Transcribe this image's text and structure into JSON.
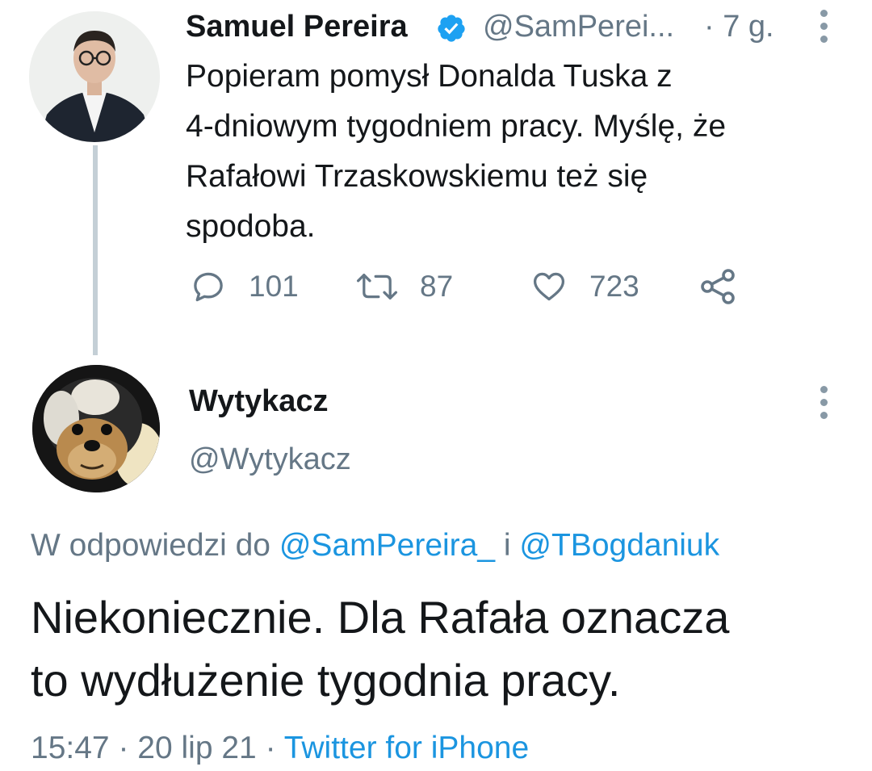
{
  "tweet1": {
    "author_name": "Samuel Pereira",
    "author_handle": "@SamPerei...",
    "time": "· 7 g.",
    "text_lines": [
      "Popieram pomysł Donalda Tuska z",
      "4-dniowym tygodniem pracy. Myślę, że",
      "Rafałowi Trzaskowskiemu też się",
      "spodoba."
    ],
    "reply_count": "101",
    "retweet_count": "87",
    "like_count": "723"
  },
  "tweet2": {
    "author_name": "Wytykacz",
    "author_handle": "@Wytykacz",
    "reply_prefix": "W odpowiedzi do ",
    "mention1": "@SamPereira_",
    "reply_joiner": " i ",
    "mention2": "@TBogdaniuk",
    "text_lines": [
      "Niekoniecznie. Dla Rafała oznacza",
      "to wydłużenie tygodnia pracy."
    ],
    "time": "15:47",
    "separator": " · ",
    "date": "20 lip 21",
    "source": "Twitter for iPhone"
  },
  "colors": {
    "primary_text": "#14171a",
    "secondary_text": "#657786",
    "link": "#1b95e0",
    "verified": "#1da1f2",
    "thread_line": "#c4cfd6"
  },
  "icons": {
    "verified": "verified-badge-icon",
    "more": "more-vertical-icon",
    "reply": "reply-icon",
    "retweet": "retweet-icon",
    "like": "heart-icon",
    "share": "share-icon"
  }
}
